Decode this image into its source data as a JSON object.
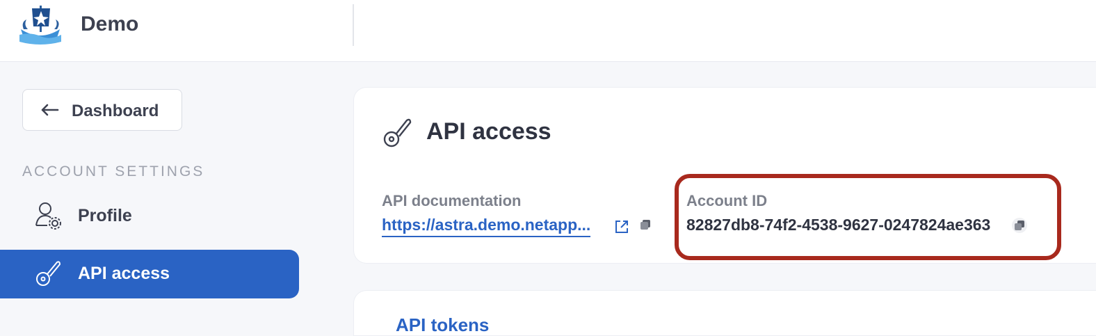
{
  "app": {
    "name": "Demo",
    "logo_icon": "viking-ship-logo"
  },
  "sidebar": {
    "back_label": "Dashboard",
    "back_icon": "arrow-left-icon",
    "section_label": "ACCOUNT SETTINGS",
    "items": [
      {
        "label": "Profile",
        "icon": "user-gear-icon",
        "active": false
      },
      {
        "label": "API access",
        "icon": "key-icon",
        "active": true
      }
    ]
  },
  "api_access": {
    "title": "API access",
    "title_icon": "key-icon",
    "documentation": {
      "label": "API documentation",
      "link_text": "https://astra.demo.netapp...",
      "external_icon": "external-link-icon",
      "copy_icon": "copy-icon"
    },
    "account": {
      "label": "Account ID",
      "value": "82827db8-74f2-4538-9627-0247824ae363",
      "copy_icon": "copy-icon"
    }
  },
  "api_tokens": {
    "title": "API tokens"
  },
  "colors": {
    "accent": "#2a63c4",
    "highlight_border": "#a8291d",
    "text": "#2f3341",
    "muted": "#7c808b"
  }
}
